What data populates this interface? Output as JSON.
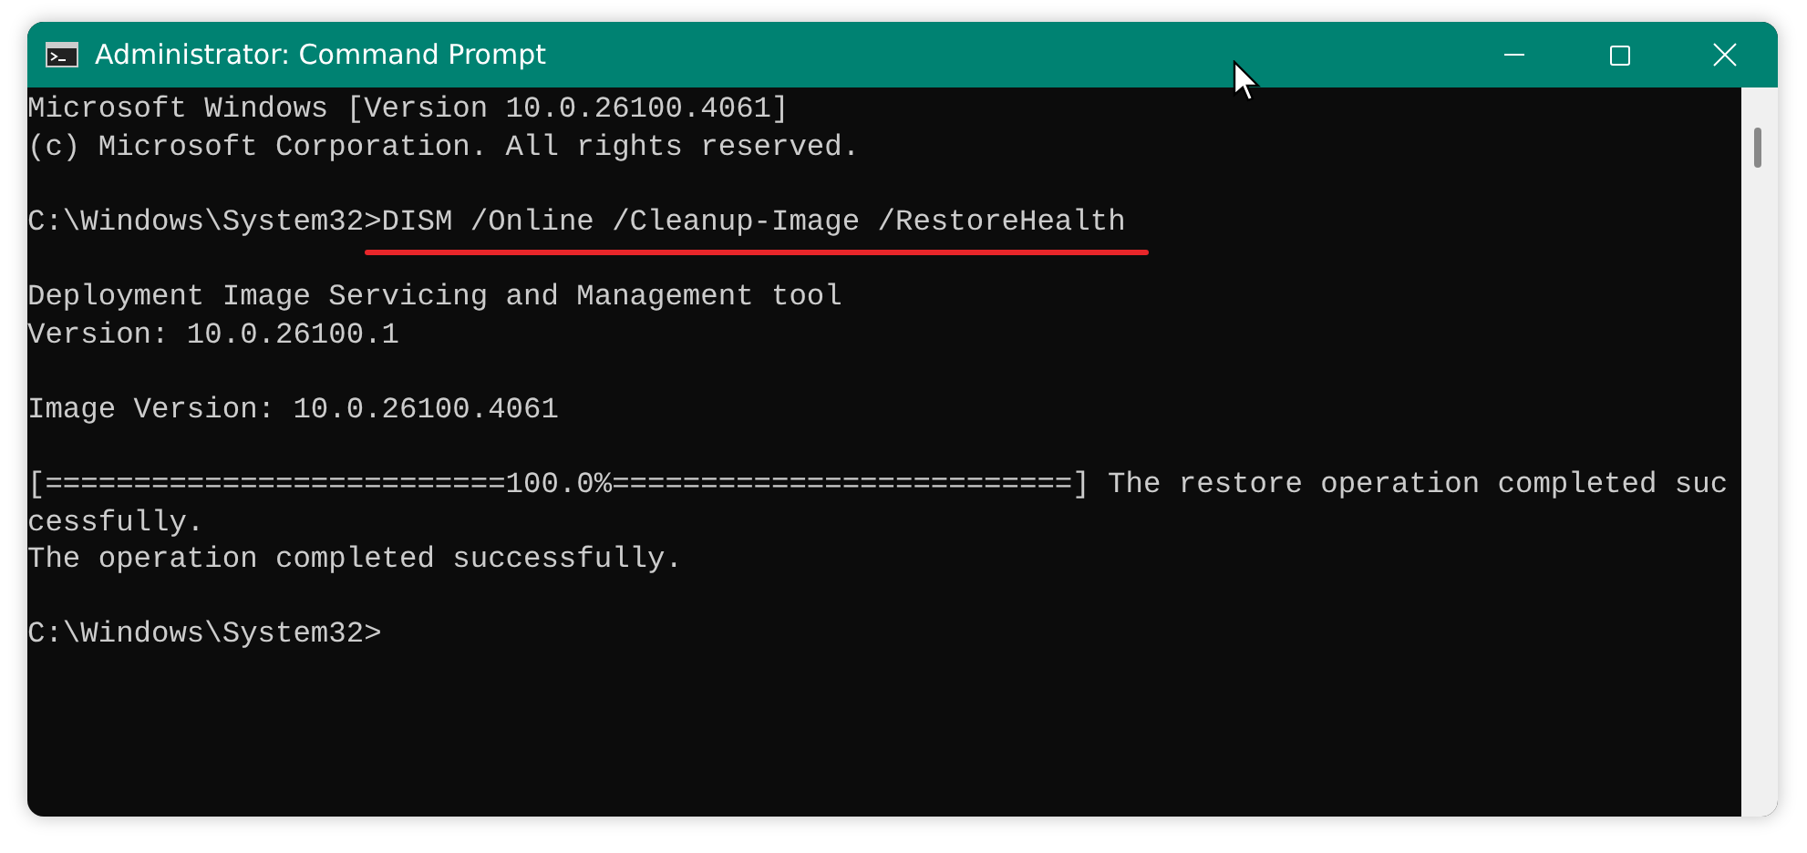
{
  "window": {
    "title": "Administrator: Command Prompt"
  },
  "console": {
    "blocks": [
      {
        "lines": [
          {
            "text": "Microsoft Windows [Version 10.0.26100.4061]"
          },
          {
            "text": "(c) Microsoft Corporation. All rights reserved."
          }
        ]
      },
      {
        "lines": [
          {
            "prompt": "C:\\Windows\\System32>",
            "command": "DISM /Online /Cleanup-Image /RestoreHealth",
            "underlined": true
          }
        ]
      },
      {
        "lines": [
          {
            "text": "Deployment Image Servicing and Management tool"
          },
          {
            "text": "Version: 10.0.26100.1"
          }
        ]
      },
      {
        "lines": [
          {
            "text": "Image Version: 10.0.26100.4061"
          }
        ]
      },
      {
        "lines": [
          {
            "text": "[==========================100.0%==========================] The restore operation completed suc"
          },
          {
            "text": "cessfully."
          },
          {
            "text": "The operation completed successfully."
          }
        ]
      },
      {
        "lines": [
          {
            "prompt": "C:\\Windows\\System32>"
          }
        ]
      }
    ]
  }
}
